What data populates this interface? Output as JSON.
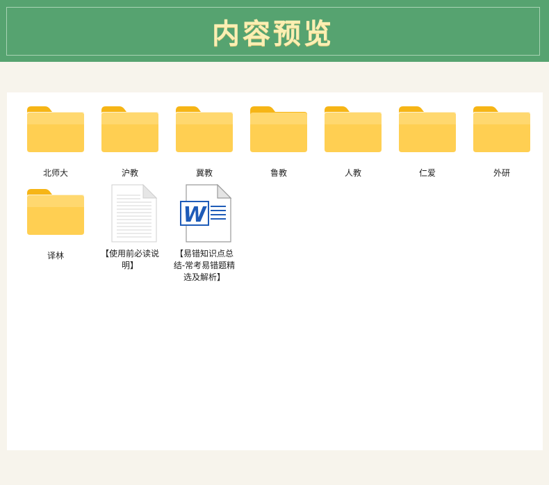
{
  "header": {
    "title": "内容预览"
  },
  "items": [
    {
      "label": "北师大",
      "type": "folder"
    },
    {
      "label": "沪教",
      "type": "folder"
    },
    {
      "label": "冀教",
      "type": "folder"
    },
    {
      "label": "鲁教",
      "type": "folder"
    },
    {
      "label": "人教",
      "type": "folder"
    },
    {
      "label": "仁爱",
      "type": "folder"
    },
    {
      "label": "外研",
      "type": "folder"
    },
    {
      "label": "译林",
      "type": "folder"
    },
    {
      "label": "【使用前必读说明】",
      "type": "text-file"
    },
    {
      "label": "【易错知识点总结-常考易错题精选及解析】",
      "type": "word-file"
    }
  ],
  "icons": {
    "folder": "folder-icon",
    "text_file": "document-icon",
    "word_file": "word-document-icon"
  },
  "colors": {
    "banner": "#56a370",
    "title": "#fbefb3",
    "folder": "#ffc83d",
    "word": "#1e5bb8"
  }
}
